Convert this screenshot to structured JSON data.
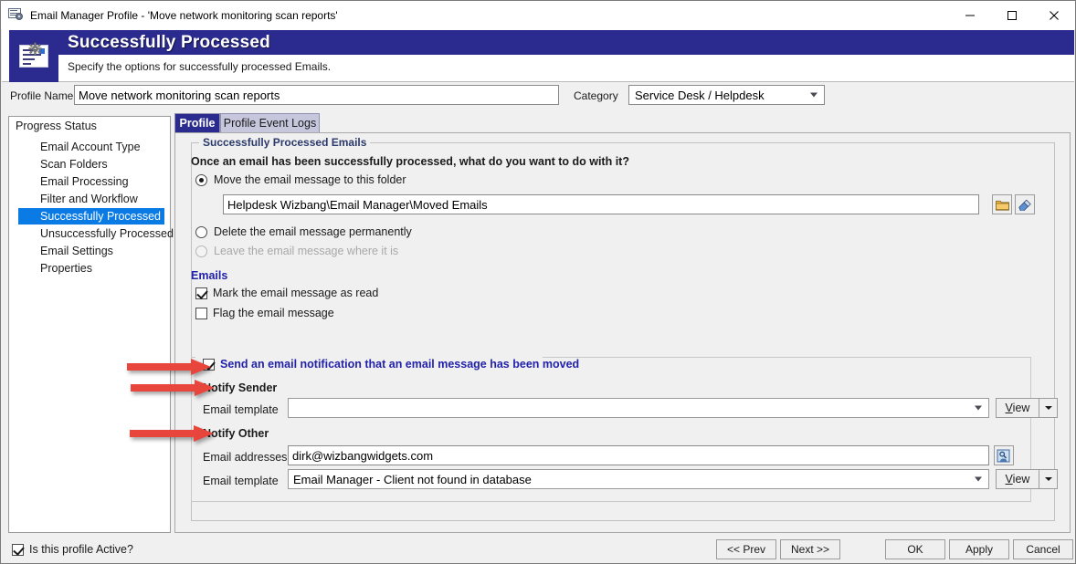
{
  "window": {
    "title": "Email Manager Profile - 'Move network monitoring scan reports'",
    "icon": "email-profile-icon",
    "minimize_label": "—",
    "maximize_label": "□",
    "close_label": "✕"
  },
  "banner": {
    "title": "Successfully Processed",
    "subtitle": "Specify the options for successfully processed Emails.",
    "icon": "document-gear-icon",
    "accent_color": "#2b2b8f"
  },
  "profile_row": {
    "name_label": "Profile Name",
    "name_value": "Move network monitoring scan reports",
    "name_placeholder": "Profile Name",
    "category_label": "Category",
    "category_value": "Service Desk / Helpdesk"
  },
  "sidebar": {
    "header": "Progress Status",
    "selected_index": 4,
    "items": [
      {
        "label": "Email Account Type"
      },
      {
        "label": "Scan Folders"
      },
      {
        "label": "Email Processing"
      },
      {
        "label": "Filter and Workflow"
      },
      {
        "label": "Successfully Processed"
      },
      {
        "label": "Unsuccessfully Processed"
      },
      {
        "label": "Email Settings"
      },
      {
        "label": "Properties"
      }
    ],
    "selection_color": "#0a7ae4"
  },
  "tabs": [
    {
      "label": "Profile",
      "active": true
    },
    {
      "label": "Profile Event Logs",
      "active": false
    }
  ],
  "main": {
    "group_legend": "Successfully Processed Emails",
    "question": "Once an email has been successfully processed, what do you want to do with it?",
    "radios": [
      {
        "label": "Move the email message to this folder",
        "checked": true,
        "disabled": false
      },
      {
        "label": "Delete the email message permanently",
        "checked": false,
        "disabled": false
      },
      {
        "label": "Leave the email message where it is",
        "checked": false,
        "disabled": true
      }
    ],
    "folder_value": "Helpdesk Wizbang\\Email Manager\\Moved Emails",
    "folder_placeholder": "Folder path",
    "browse_button_icon": "folder-icon",
    "clear_button_icon": "eraser-icon",
    "emails_section_label": "Emails",
    "email_checkboxes": [
      {
        "label": "Mark the email message as read",
        "checked": true
      },
      {
        "label": "Flag the email message",
        "checked": false
      }
    ],
    "notify": {
      "enable_label": "Send an email notification that an email message has been moved",
      "enable_checked": true,
      "sender_heading": "Notify Sender",
      "sender_template_label": "Email template",
      "sender_template_value": "",
      "sender_template_placeholder": "",
      "other_heading": "Notify Other",
      "other_addresses_label": "Email addresses",
      "other_addresses_value": "dirk@wizbangwidgets.com",
      "other_addresses_placeholder": "Email addresses",
      "other_template_label": "Email template",
      "other_template_value": "Email Manager - Client not found in database",
      "address_book_icon": "address-book-lookup-icon",
      "view_button_label": "View",
      "view_button_mnemonic": "V",
      "view_button_rest": "iew"
    }
  },
  "bottom": {
    "active_checkbox_label": "Is this profile Active?",
    "active_checked": true,
    "prev_label": "<< Prev",
    "next_label": "Next >>",
    "ok_label": "OK",
    "apply_label": "Apply",
    "cancel_label": "Cancel"
  },
  "annotations": {
    "arrow_color": "#e8453c",
    "arrows": [
      {
        "name": "arrow-send-notification"
      },
      {
        "name": "arrow-notify-sender"
      },
      {
        "name": "arrow-notify-other"
      }
    ]
  }
}
